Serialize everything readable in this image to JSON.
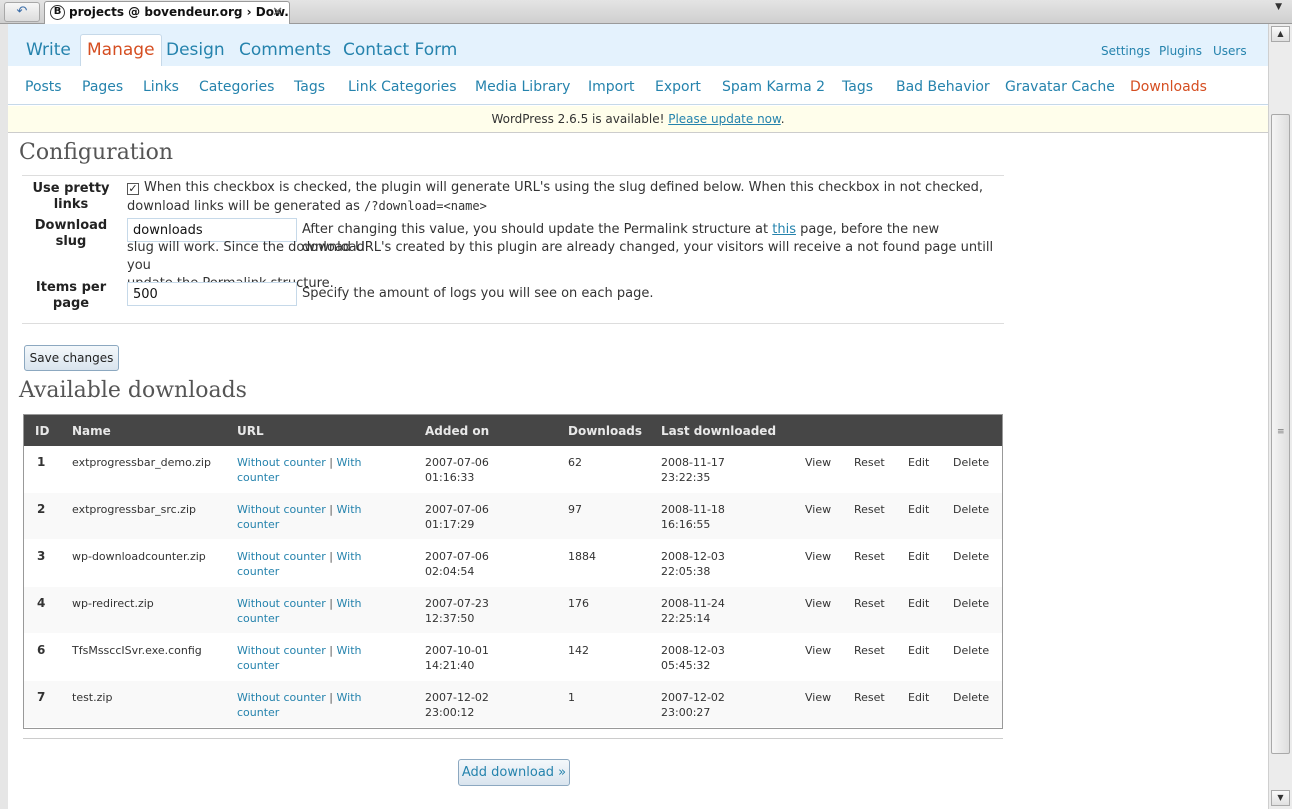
{
  "browser": {
    "tab_title": "projects @ bovendeur.org › Dow...",
    "favicon_letter": "B",
    "close_glyph": "✕",
    "menu_glyph": "▼",
    "nav_glyph": "↶"
  },
  "top_nav": {
    "items": [
      "Write",
      "Manage",
      "Design",
      "Comments",
      "Contact Form"
    ],
    "current": "Manage",
    "right_items": [
      "Settings",
      "Plugins",
      "Users"
    ]
  },
  "sub_nav": {
    "items": [
      "Posts",
      "Pages",
      "Links",
      "Categories",
      "Tags",
      "Link Categories",
      "Media Library",
      "Import",
      "Export",
      "Spam Karma 2",
      "Tags",
      "Bad Behavior",
      "Gravatar Cache",
      "Downloads"
    ],
    "current": "Downloads"
  },
  "update_nag": {
    "text": "WordPress 2.6.5 is available! ",
    "link": "Please update now",
    "suffix": "."
  },
  "configuration": {
    "title": "Configuration",
    "pretty_links": {
      "label_line1": "Use pretty",
      "label_line2": "links",
      "checked_glyph": "✓",
      "desc_line1": "When this checkbox is checked, the plugin will generate URL's using the slug defined below. When this checkbox in not checked,",
      "desc_line2_prefix": "download links will be generated as ",
      "desc_code": "/?download=<name>"
    },
    "download_slug": {
      "label_line1": "Download",
      "label_line2": "slug",
      "value": "downloads",
      "desc_line1_prefix": "After changing this value, you should update the Permalink structure at ",
      "desc_link": "this",
      "desc_line1_suffix": " page, before the new download",
      "desc_line2": "slug will work. Since the download URL's created by this plugin are already changed, your visitors will receive a not found page untill you",
      "desc_line3": "update the Permalink structure."
    },
    "items_per_page": {
      "label_line1": "Items per",
      "label_line2": "page",
      "value": "500",
      "desc": "Specify the amount of logs you will see on each page."
    },
    "save_label": "Save changes"
  },
  "downloads": {
    "title": "Available downloads",
    "headers": [
      "ID",
      "Name",
      "URL",
      "Added on",
      "Downloads",
      "Last downloaded"
    ],
    "url_without": "Without counter",
    "url_sep": " | ",
    "url_with_1": "With",
    "url_with_2": "counter",
    "actions": [
      "View",
      "Reset",
      "Edit",
      "Delete"
    ],
    "rows": [
      {
        "id": "1",
        "name": "extprogressbar_demo.zip",
        "added_date": "2007-07-06",
        "added_time": "01:16:33",
        "downloads": "62",
        "last_date": "2008-11-17",
        "last_time": "23:22:35"
      },
      {
        "id": "2",
        "name": "extprogressbar_src.zip",
        "added_date": "2007-07-06",
        "added_time": "01:17:29",
        "downloads": "97",
        "last_date": "2008-11-18",
        "last_time": "16:16:55"
      },
      {
        "id": "3",
        "name": "wp-downloadcounter.zip",
        "added_date": "2007-07-06",
        "added_time": "02:04:54",
        "downloads": "1884",
        "last_date": "2008-12-03",
        "last_time": "22:05:38"
      },
      {
        "id": "4",
        "name": "wp-redirect.zip",
        "added_date": "2007-07-23",
        "added_time": "12:37:50",
        "downloads": "176",
        "last_date": "2008-11-24",
        "last_time": "22:25:14"
      },
      {
        "id": "6",
        "name": "TfsMssccISvr.exe.config",
        "added_date": "2007-10-01",
        "added_time": "14:21:40",
        "downloads": "142",
        "last_date": "2008-12-03",
        "last_time": "05:45:32"
      },
      {
        "id": "7",
        "name": "test.zip",
        "added_date": "2007-12-02",
        "added_time": "23:00:12",
        "downloads": "1",
        "last_date": "2007-12-02",
        "last_time": "23:00:27"
      }
    ],
    "add_label": "Add download »"
  },
  "scrollbar": {
    "up_glyph": "▲",
    "down_glyph": "▼",
    "grip_glyph": "≡"
  }
}
